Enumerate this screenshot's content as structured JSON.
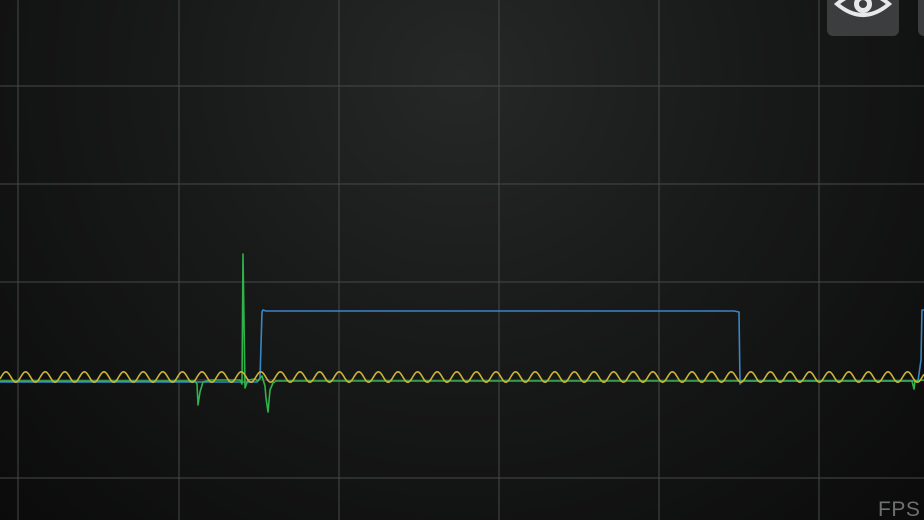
{
  "status": {
    "fps_label": "FPS"
  },
  "toolbar": {
    "visibility_icon": "eye-icon",
    "edge_icon": "truncated-button"
  },
  "colors": {
    "grid": "#474848",
    "yellow_trace": "#cdb436",
    "blue_trace": "#3a86c4",
    "green_trace": "#2fb34a"
  }
}
